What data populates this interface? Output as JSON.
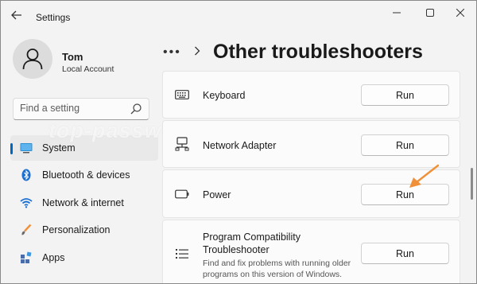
{
  "window": {
    "title": "Settings",
    "back_icon": "back-arrow-icon",
    "controls": [
      "minimize-icon",
      "maximize-icon",
      "close-icon"
    ]
  },
  "user": {
    "name": "Tom",
    "account_type": "Local Account"
  },
  "search": {
    "placeholder": "Find a setting"
  },
  "sidebar": {
    "items": [
      {
        "label": "System",
        "icon": "system-monitor-icon",
        "active": true
      },
      {
        "label": "Bluetooth & devices",
        "icon": "bluetooth-icon",
        "active": false
      },
      {
        "label": "Network & internet",
        "icon": "wifi-icon",
        "active": false
      },
      {
        "label": "Personalization",
        "icon": "brush-icon",
        "active": false
      },
      {
        "label": "Apps",
        "icon": "apps-icon",
        "active": false
      }
    ]
  },
  "breadcrumb": {
    "more": "•••",
    "separator": ">",
    "title": "Other troubleshooters"
  },
  "troubleshooters": [
    {
      "title": "Keyboard",
      "icon": "keyboard-icon",
      "button": "Run"
    },
    {
      "title": "Network Adapter",
      "icon": "network-adapter-icon",
      "button": "Run"
    },
    {
      "title": "Power",
      "icon": "battery-icon",
      "button": "Run"
    },
    {
      "title_line1": "Program Compatibility",
      "title_line2": "Troubleshooter",
      "description_line1": "Find and fix problems with running older",
      "description_line2": "programs on this version of Windows.",
      "icon": "list-icon",
      "button": "Run"
    }
  ],
  "watermark": "top-password.com",
  "colors": {
    "accent": "#0067c0",
    "pointer_arrow": "#f0913a",
    "background": "#f3f3f3",
    "card": "#fbfbfb"
  }
}
